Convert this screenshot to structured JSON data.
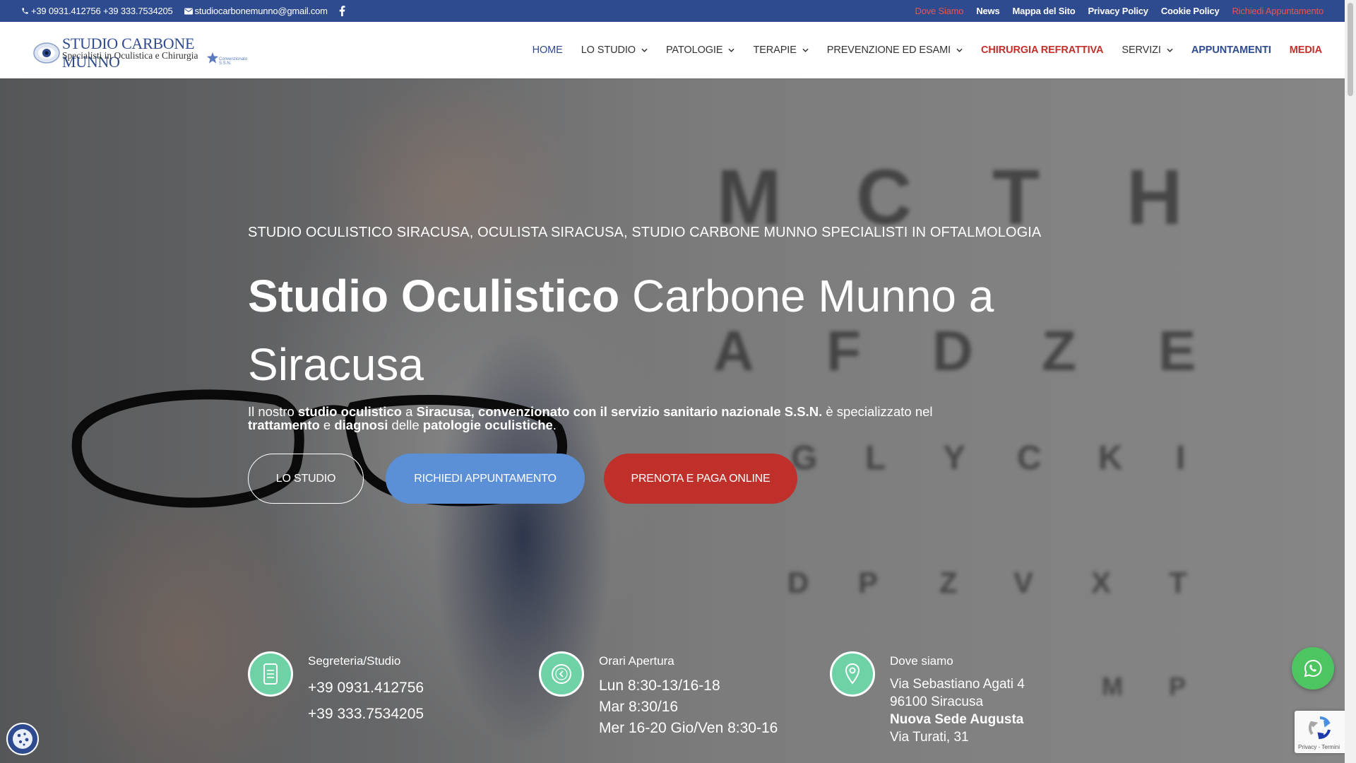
{
  "topbar": {
    "phones": "+39 0931.412756 +39 333.7534205",
    "email": "studiocarbonemunno@gmail.com",
    "links": [
      "Dove Siamo",
      "News",
      "Mappa del Sito",
      "Privacy Policy",
      "Cookie Policy",
      "Richiedi Appuntamento"
    ],
    "background": "#2e4b8f",
    "accent": "#e8554e"
  },
  "logo": {
    "title": "STUDIO CARBONE MUNNO",
    "subtitle": "Specialisti in Oculistica e Chirurgia",
    "badge": "Convenzionato S.S.N."
  },
  "nav": {
    "items": [
      {
        "label": "HOME",
        "has_dropdown": false
      },
      {
        "label": "LO STUDIO",
        "has_dropdown": true
      },
      {
        "label": "PATOLOGIE",
        "has_dropdown": true
      },
      {
        "label": "TERAPIE",
        "has_dropdown": true
      },
      {
        "label": "PREVENZIONE ED ESAMI",
        "has_dropdown": true
      },
      {
        "label": "CHIRURGIA REFRATTIVA",
        "has_dropdown": false
      },
      {
        "label": "SERVIZI",
        "has_dropdown": true
      },
      {
        "label": "APPUNTAMENTI",
        "has_dropdown": false
      },
      {
        "label": "MEDIA",
        "has_dropdown": false
      }
    ]
  },
  "hero": {
    "kicker": "STUDIO OCULISTICO SIRACUSA, OCULISTA SIRACUSA, STUDIO CARBONE MUNNO SPECIALISTI IN OFTALMOLOGIA",
    "headline_bold": "Studio Oculistico",
    "headline_rest": "Carbone Munno a Siracusa",
    "desc": {
      "p1": "Il nostro ",
      "b1": "studio oculistico",
      "p2": " a ",
      "b2": "Siracusa, convenzionato con il servizio sanitario nazionale S.S.N.",
      "p3": " è specializzato nel ",
      "b3": "trattamento",
      "p4": " e ",
      "b4": "diagnosi",
      "p5": " delle ",
      "b5": "patologie oculistiche",
      "p6": "."
    },
    "buttons": [
      "LO STUDIO",
      "RICHIEDI APPUNTAMENTO",
      "PRENOTA E PAGA ONLINE"
    ],
    "eye_chart_letters": [
      "M",
      "C",
      "T",
      "H",
      "A",
      "F",
      "D",
      "Z",
      "E",
      "G",
      "L",
      "Y",
      "C",
      "K",
      "I",
      "D",
      "P",
      "Z",
      "V",
      "X",
      "T",
      "M",
      "P"
    ]
  },
  "info": {
    "phone": {
      "label": "Segreteria/Studio",
      "lines": [
        "+39 0931.412756",
        "+39 333.7534205"
      ],
      "icon": "phone-icon"
    },
    "hours": {
      "label": "Orari Apertura",
      "lines": [
        "Lun 8:30-13/16-18",
        "Mar 8:30/16",
        "Mer 16-20 Gio/Ven 8:30-16"
      ],
      "icon": "clock-icon"
    },
    "location": {
      "label": "Dove siamo",
      "lines": [
        "Via Sebastiano Agati 4",
        "96100 Siracusa",
        "Nuova Sede Augusta",
        "Via Turati, 31"
      ],
      "icon": "map-pin-icon"
    }
  },
  "widgets": {
    "recaptcha_text": "Privacy - Termini"
  },
  "colors": {
    "primary": "#2e4b8f",
    "red": "#c0302b",
    "button_blue": "#5b8fd6",
    "icon_green": "#6ed2a6",
    "whatsapp": "#4dc560"
  }
}
